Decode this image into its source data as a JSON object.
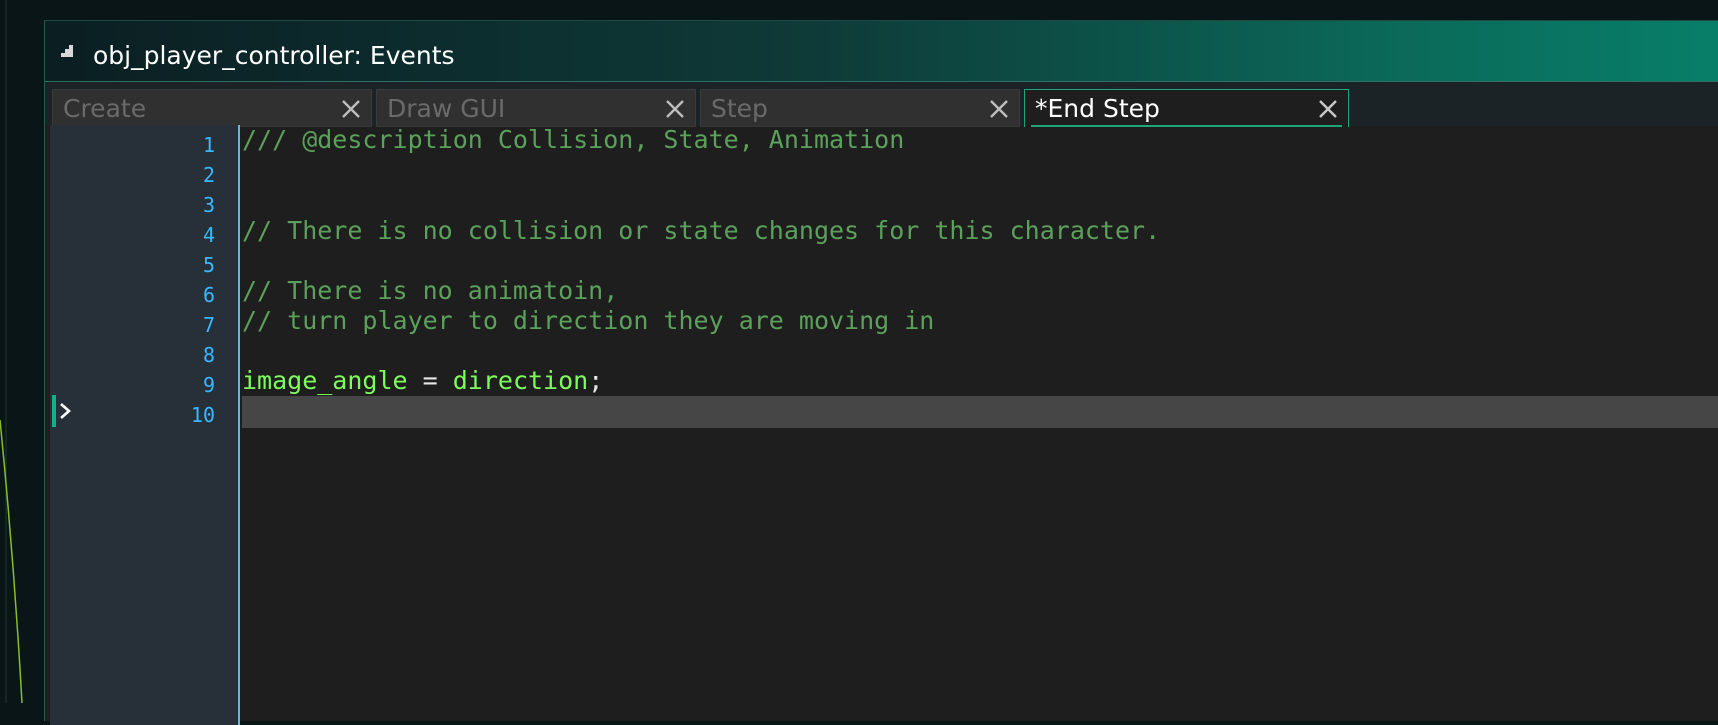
{
  "window": {
    "title": "obj_player_controller: Events"
  },
  "tabs": [
    {
      "label": "Create",
      "active": false
    },
    {
      "label": "Draw GUI",
      "active": false
    },
    {
      "label": "Step",
      "active": false
    },
    {
      "label": "*End Step",
      "active": true
    }
  ],
  "editor": {
    "line_numbers": [
      "1",
      "2",
      "3",
      "4",
      "5",
      "6",
      "7",
      "8",
      "9",
      "10"
    ],
    "current_line": "10",
    "lines": {
      "l1": "/// @description Collision, State, Animation",
      "l4": "// There is no collision or state changes for this character.",
      "l6": "// There is no animatoin,",
      "l7": "// turn player to direction they are moving in",
      "l9": {
        "lhs": "image_angle",
        "op": " = ",
        "rhs": "direction",
        "end": ";"
      }
    }
  },
  "colors": {
    "accent": "#1ea57a",
    "comment": "#5ba15b",
    "variable": "#7dff5b",
    "line_number": "#38b8ff"
  },
  "icons": {
    "title": "event-editor-icon",
    "tab_close": "close-icon",
    "current_line_marker": "chevron-right-icon"
  }
}
